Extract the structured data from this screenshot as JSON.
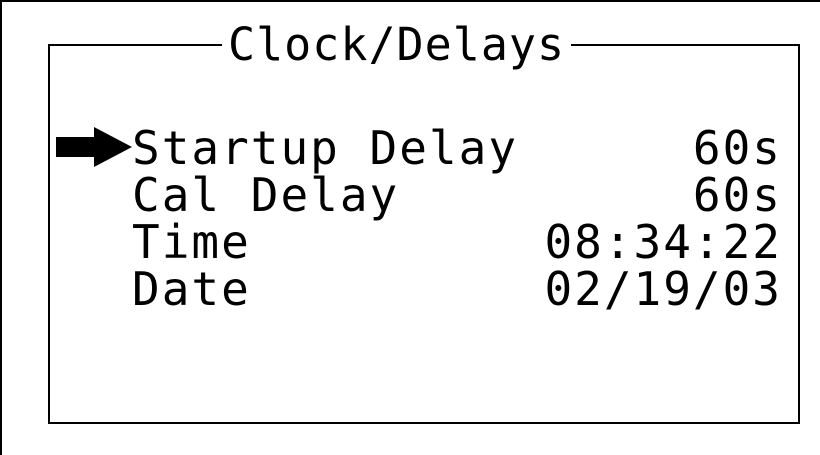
{
  "menu": {
    "title": "Clock/Delays",
    "selected_index": 0,
    "items": [
      {
        "label": "Startup Delay",
        "value": "60s"
      },
      {
        "label": "Cal Delay",
        "value": "60s"
      },
      {
        "label": "Time",
        "value": "08:34:22"
      },
      {
        "label": "Date",
        "value": "02/19/03"
      }
    ]
  },
  "icons": {
    "cursor": "selection-arrow-icon"
  },
  "colors": {
    "background": "#ffffff",
    "foreground": "#000000"
  }
}
